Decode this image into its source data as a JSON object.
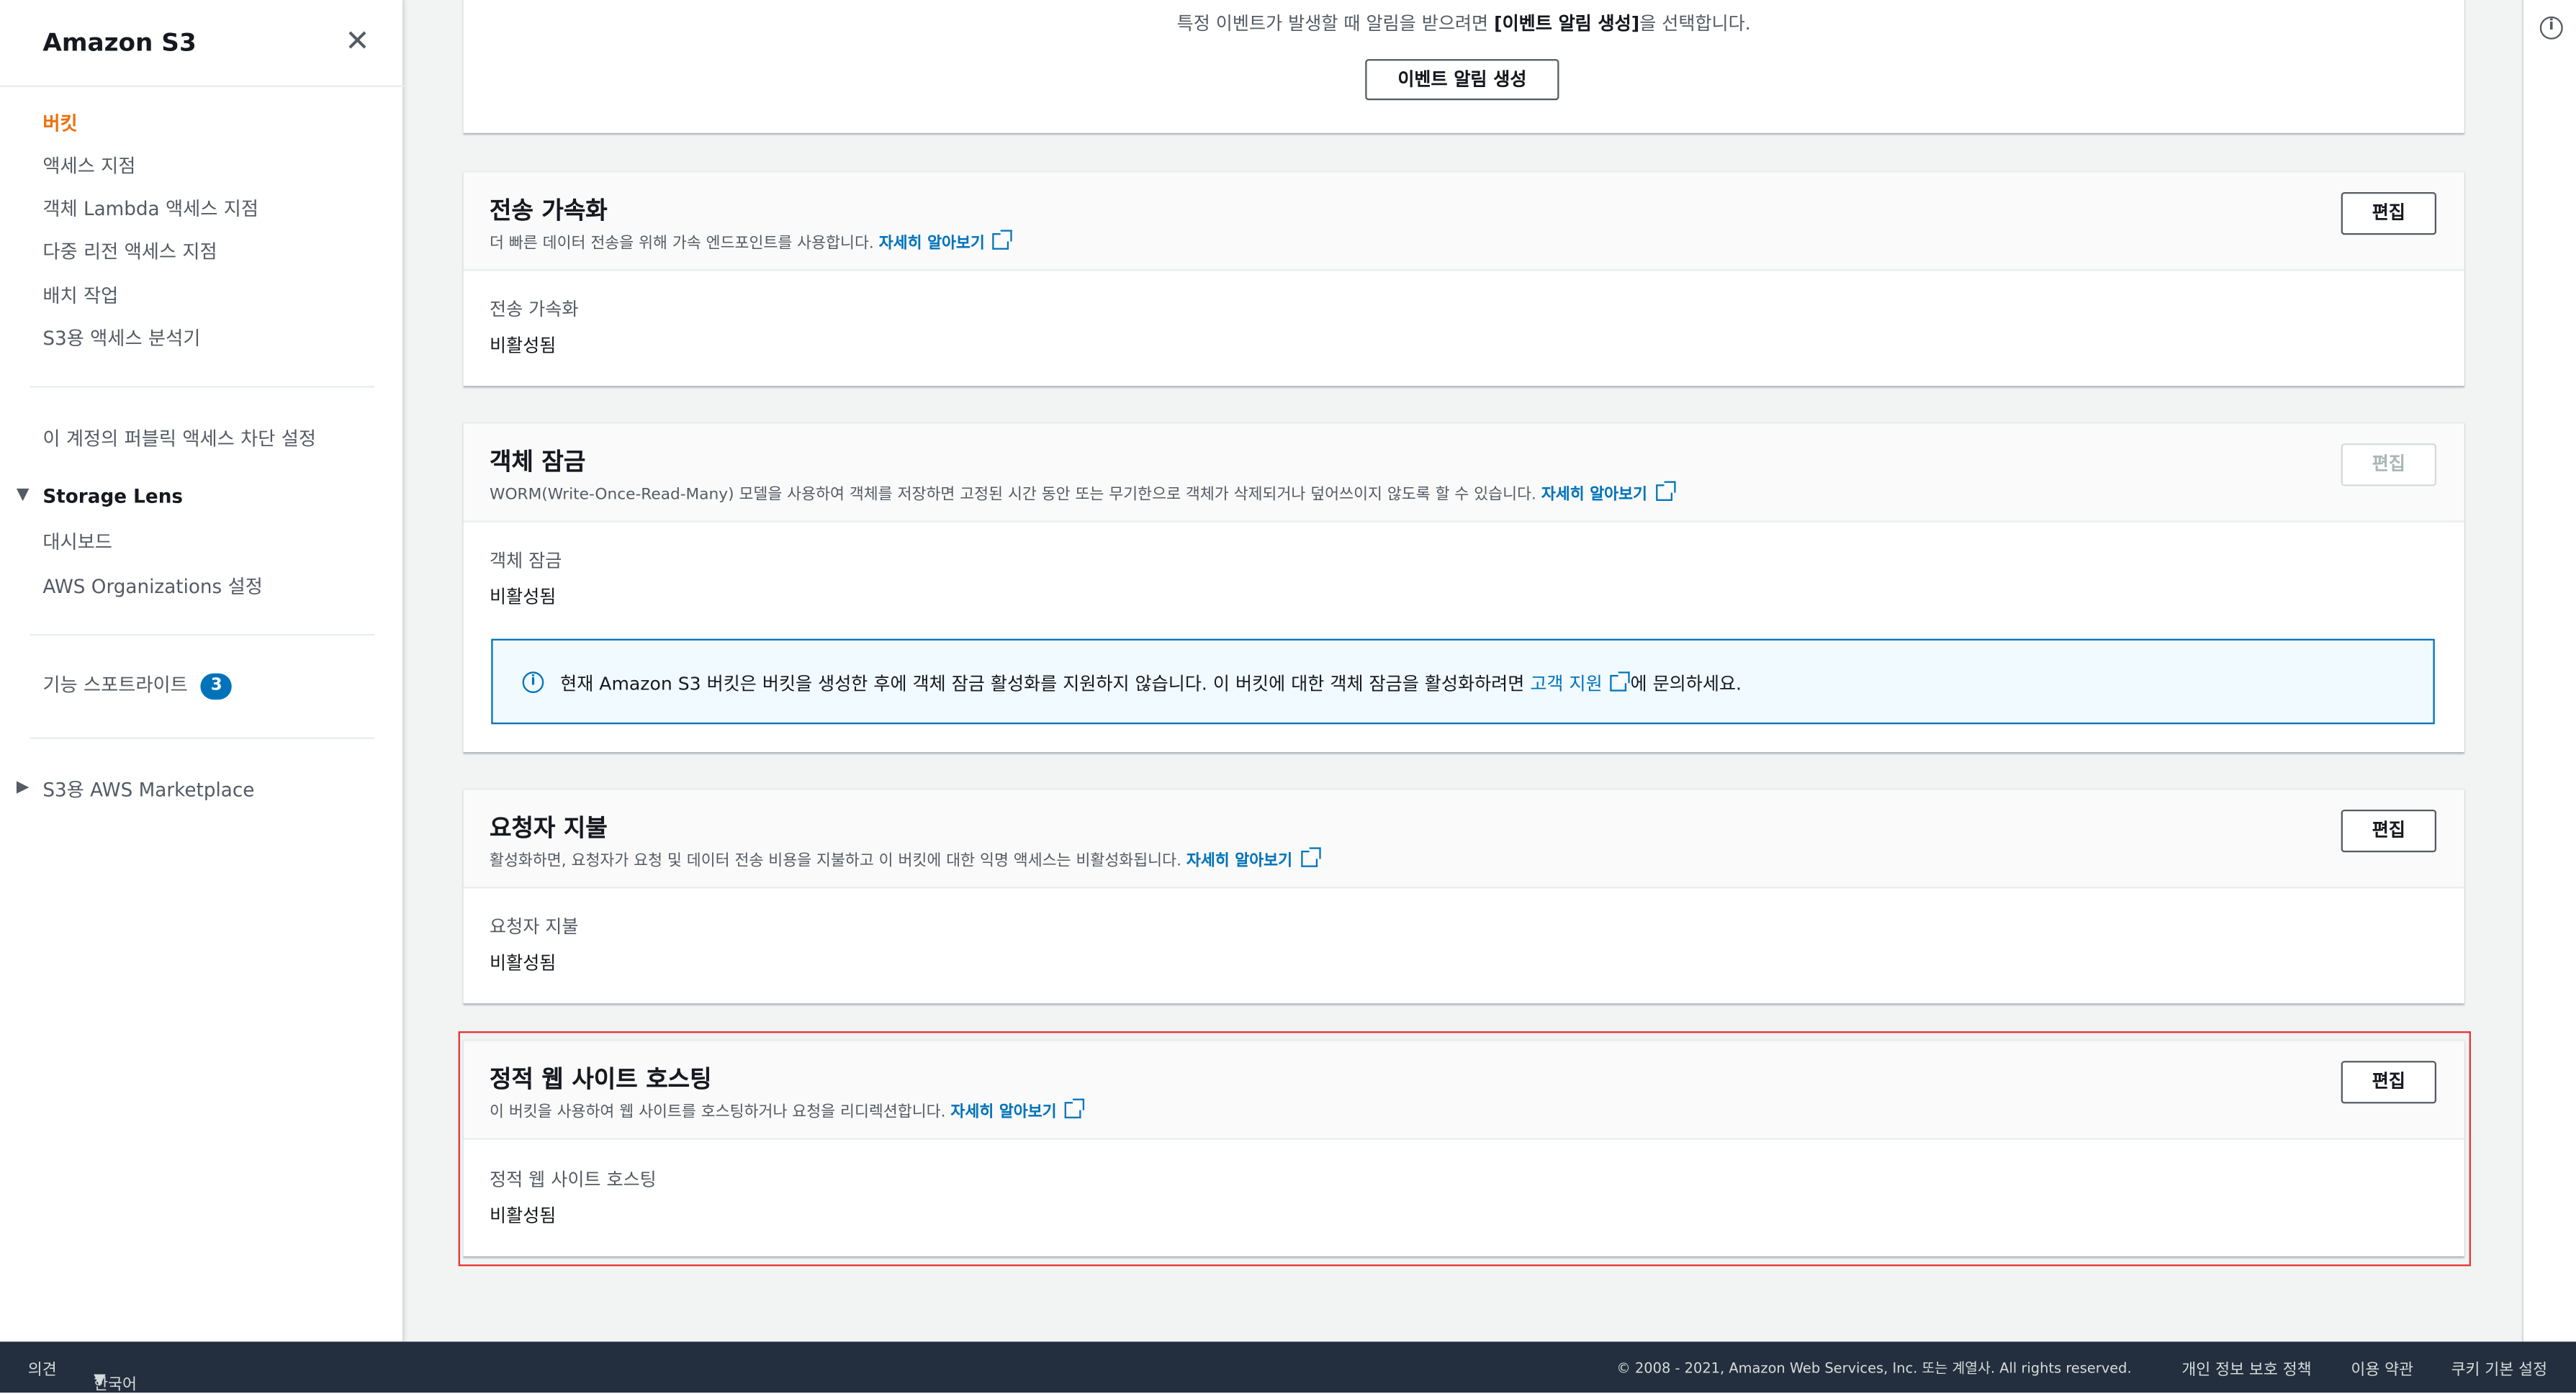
{
  "sidebar": {
    "title": "Amazon S3",
    "items": [
      {
        "label": "버킷",
        "active": true
      },
      {
        "label": "액세스 지점"
      },
      {
        "label": "객체 Lambda 액세스 지점"
      },
      {
        "label": "다중 리전 액세스 지점"
      },
      {
        "label": "배치 작업"
      },
      {
        "label": "S3용 액세스 분석기"
      }
    ],
    "public_access": "이 계정의 퍼블릭 액세스 차단 설정",
    "storage_lens": {
      "label": "Storage Lens",
      "expanded": true,
      "items": [
        "대시보드",
        "AWS Organizations 설정"
      ]
    },
    "feature_spotlight": {
      "label": "기능 스포트라이트",
      "count": "3"
    },
    "marketplace": {
      "label": "S3용 AWS Marketplace",
      "expanded": false
    }
  },
  "events": {
    "text_pre": "특정 이벤트가 발생할 때 알림을 받으려면 ",
    "text_bold": "[이벤트 알림 생성]",
    "text_post": "을 선택합니다.",
    "button": "이벤트 알림 생성"
  },
  "sections": [
    {
      "title": "전송 가속화",
      "desc": "더 빠른 데이터 전송을 위해 가속 엔드포인트를 사용합니다.",
      "link": "자세히 알아보기",
      "edit": "편집",
      "edit_disabled": false,
      "label": "전송 가속화",
      "value": "비활성됨"
    },
    {
      "title": "객체 잠금",
      "desc": "WORM(Write-Once-Read-Many) 모델을 사용하여 객체를 저장하면 고정된 시간 동안 또는 무기한으로 객체가 삭제되거나 덮어쓰이지 않도록 할 수 있습니다.",
      "link": "자세히 알아보기",
      "edit": "편집",
      "edit_disabled": true,
      "label": "객체 잠금",
      "value": "비활성됨",
      "info": {
        "pre": "현재 Amazon S3 버킷은 버킷을 생성한 후에 객체 잠금 활성화를 지원하지 않습니다. 이 버킷에 대한 객체 잠금을 활성화하려면 ",
        "link": "고객 지원",
        "post": "에 문의하세요."
      }
    },
    {
      "title": "요청자 지불",
      "desc": "활성화하면, 요청자가 요청 및 데이터 전송 비용을 지불하고 이 버킷에 대한 익명 액세스는 비활성화됩니다.",
      "link": "자세히 알아보기",
      "edit": "편집",
      "edit_disabled": false,
      "label": "요청자 지불",
      "value": "비활성됨"
    },
    {
      "title": "정적 웹 사이트 호스팅",
      "desc": "이 버킷을 사용하여 웹 사이트를 호스팅하거나 요청을 리디렉션합니다.",
      "link": "자세히 알아보기",
      "edit": "편집",
      "edit_disabled": false,
      "label": "정적 웹 사이트 호스팅",
      "value": "비활성됨",
      "highlighted": true
    }
  ],
  "footer": {
    "feedback": "의견",
    "language": "한국어",
    "copyright": "© 2008 - 2021, Amazon Web Services, Inc. 또는 계열사. All rights reserved.",
    "privacy": "개인 정보 보호 정책",
    "terms": "이용 약관",
    "cookies": "쿠키 기본 설정"
  },
  "colors": {
    "accent": "#ec7211",
    "link": "#0073bb",
    "footer": "#232f3e",
    "highlight": "#e3342f"
  }
}
